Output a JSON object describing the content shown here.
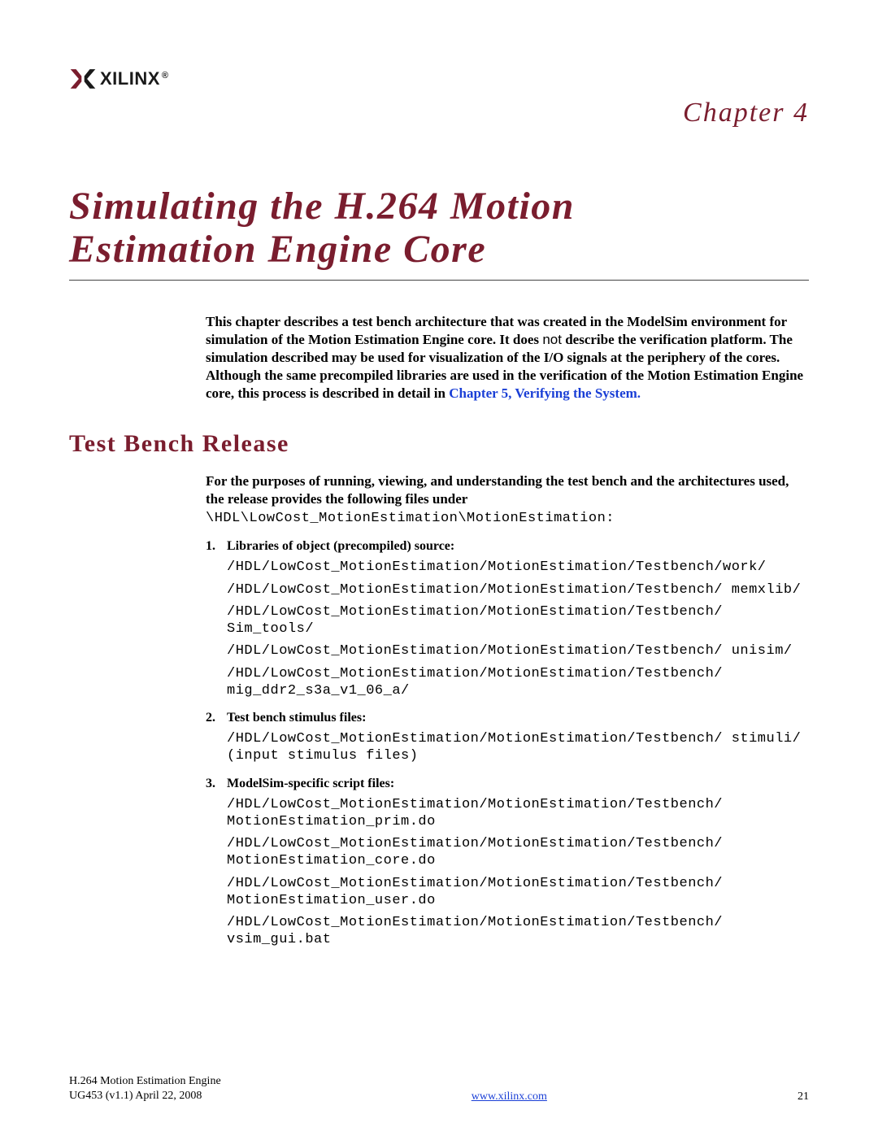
{
  "header": {
    "logo_text": "XILINX",
    "chapter_label": "Chapter 4"
  },
  "title_line1": "Simulating the H.264 Motion",
  "title_line2": "Estimation Engine Core",
  "intro": {
    "p1a": "This chapter describes a test bench architecture that was created in the ModelSim environment for simulation of the Motion Estimation Engine core. It does ",
    "p1_not": "not",
    "p1b": " describe the verification platform. The simulation described may be used for visualization of the I/O signals at the periphery of the cores. Although the same precompiled libraries are used in the verification of the Motion Estimation Engine core, this process is described in detail in ",
    "xref": "Chapter 5, Verifying the System."
  },
  "section1": {
    "heading": "Test Bench Release",
    "intro_a": "For the purposes of running, viewing, and understanding the test bench and the architectures used, the release provides the following files under ",
    "intro_path": "\\HDL\\LowCost_MotionEstimation\\MotionEstimation:"
  },
  "lists": {
    "item1": {
      "num": "1.",
      "title": "Libraries of object (precompiled) source:",
      "paths": [
        "/HDL/LowCost_MotionEstimation/MotionEstimation/Testbench/work/",
        "/HDL/LowCost_MotionEstimation/MotionEstimation/Testbench/ memxlib/",
        "/HDL/LowCost_MotionEstimation/MotionEstimation/Testbench/ Sim_tools/",
        "/HDL/LowCost_MotionEstimation/MotionEstimation/Testbench/ unisim/",
        "/HDL/LowCost_MotionEstimation/MotionEstimation/Testbench/ mig_ddr2_s3a_v1_06_a/"
      ]
    },
    "item2": {
      "num": "2.",
      "title": "Test bench stimulus files:",
      "paths": [
        "/HDL/LowCost_MotionEstimation/MotionEstimation/Testbench/ stimuli/ (input stimulus files)"
      ]
    },
    "item3": {
      "num": "3.",
      "title": "ModelSim-specific script files:",
      "paths": [
        "/HDL/LowCost_MotionEstimation/MotionEstimation/Testbench/ MotionEstimation_prim.do",
        "/HDL/LowCost_MotionEstimation/MotionEstimation/Testbench/ MotionEstimation_core.do",
        "/HDL/LowCost_MotionEstimation/MotionEstimation/Testbench/ MotionEstimation_user.do",
        "/HDL/LowCost_MotionEstimation/MotionEstimation/Testbench/ vsim_gui.bat"
      ]
    }
  },
  "footer": {
    "doc_title": "H.264 Motion Estimation Engine",
    "doc_id": "UG453 (v1.1) April 22, 2008",
    "url": "www.xilinx.com",
    "page": "21"
  }
}
